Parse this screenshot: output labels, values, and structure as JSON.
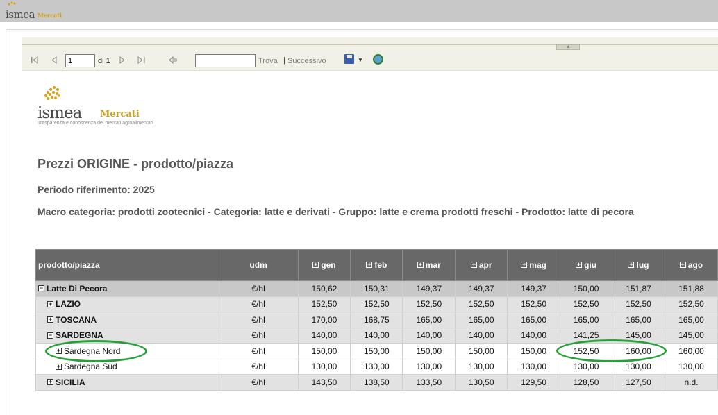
{
  "app": {
    "brand": "ismea",
    "brand_sub": "Mercati"
  },
  "toolbar": {
    "first_icon": "first-page-icon",
    "prev_icon": "prev-page-icon",
    "page_value": "1",
    "of_label": "di 1",
    "next_icon": "next-page-icon",
    "last_icon": "last-page-icon",
    "back_icon": "back-icon",
    "find_value": "",
    "find_label": "Trova",
    "separator": "|",
    "next_label": "Successivo",
    "export_icon": "save-icon",
    "refresh_icon": "refresh-icon"
  },
  "logo": {
    "main": "ismea",
    "mercati": "Mercati",
    "tagline": "Trasparenza e conoscenza dei mercati agroalimentari"
  },
  "report": {
    "title": "Prezzi ORIGINE - prodotto/piazza",
    "period": "Periodo riferimento: 2025",
    "macro": "Macro categoria: prodotti zootecnici - Categoria: latte e derivati - Gruppo: latte e crema prodotti freschi - Prodotto: latte di pecora"
  },
  "table": {
    "headers": [
      "prodotto/piazza",
      "udm",
      "gen",
      "feb",
      "mar",
      "apr",
      "mag",
      "giu",
      "lug",
      "ago"
    ],
    "rows": [
      {
        "label": "Latte Di Pecora",
        "toggle": "⊟",
        "level": 0,
        "cells": [
          "€/hl",
          "150,62",
          "150,31",
          "149,37",
          "149,37",
          "149,37",
          "150,00",
          "151,87",
          "151,88"
        ]
      },
      {
        "label": "LAZIO",
        "toggle": "⊞",
        "level": 1,
        "cells": [
          "€/hl",
          "152,50",
          "152,50",
          "152,50",
          "152,50",
          "152,50",
          "152,50",
          "152,50",
          "152,50"
        ]
      },
      {
        "label": "TOSCANA",
        "toggle": "⊞",
        "level": 1,
        "cells": [
          "€/hl",
          "170,00",
          "168,75",
          "165,00",
          "165,00",
          "165,00",
          "165,00",
          "165,00",
          "165,00"
        ]
      },
      {
        "label": "SARDEGNA",
        "toggle": "⊟",
        "level": 1,
        "cells": [
          "€/hl",
          "140,00",
          "140,00",
          "140,00",
          "140,00",
          "140,00",
          "141,25",
          "145,00",
          "145,00"
        ]
      },
      {
        "label": "Sardegna Nord",
        "toggle": "⊞",
        "level": 2,
        "cells": [
          "€/hl",
          "150,00",
          "150,00",
          "150,00",
          "150,00",
          "150,00",
          "152,50",
          "160,00",
          "160,00"
        ]
      },
      {
        "label": "Sardegna Sud",
        "toggle": "⊞",
        "level": 2,
        "cells": [
          "€/hl",
          "130,00",
          "130,00",
          "130,00",
          "130,00",
          "130,00",
          "130,00",
          "130,00",
          "130,00"
        ]
      },
      {
        "label": "SICILIA",
        "toggle": "⊞",
        "level": 1,
        "cells": [
          "€/hl",
          "143,50",
          "138,50",
          "133,50",
          "130,50",
          "129,50",
          "128,50",
          "127,50",
          "n.d."
        ]
      }
    ]
  },
  "colors": {
    "highlight_ellipse": "#27a03a",
    "header_bg": "#686868"
  }
}
